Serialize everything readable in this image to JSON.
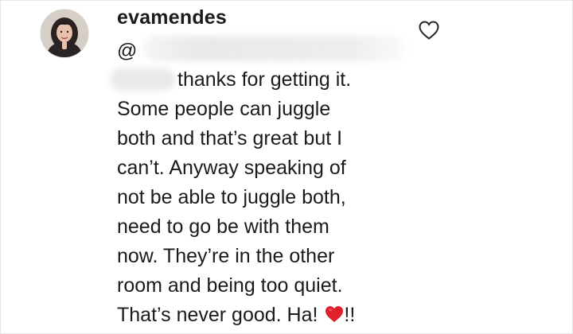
{
  "comment": {
    "username": "evamendes",
    "mention_prefix": "@",
    "lines": [
      "thanks for getting it.",
      "Some people can juggle",
      "both and that’s great but I",
      "can’t. Anyway speaking of",
      "not be able to juggle both,",
      "need to go be with them",
      "now. They’re in the other",
      "room and being too quiet.",
      "That’s never good. Ha!"
    ],
    "ending": "!!",
    "emoji": "red-heart-icon",
    "like_icon": "heart-outline-icon"
  },
  "colors": {
    "text": "#1b1b1b",
    "heart_red": "#e0202b",
    "background": "#ffffff"
  }
}
